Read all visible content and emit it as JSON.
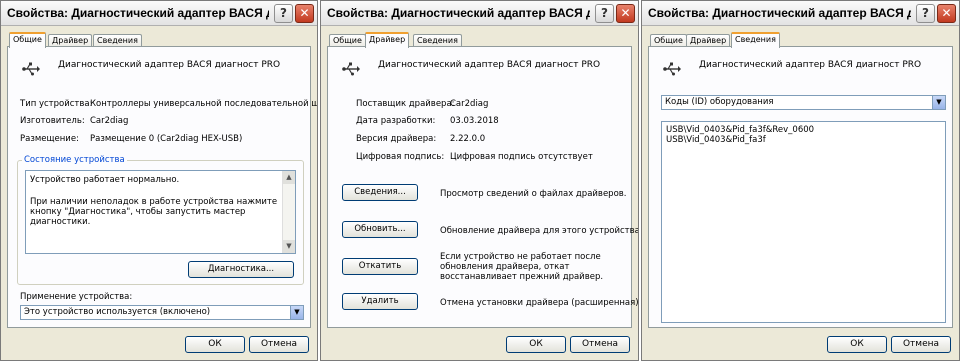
{
  "window_title": "Свойства: Диагностический адаптер ВАСЯ диагнос",
  "help_glyph": "?",
  "close_glyph": "✕",
  "tabs": [
    "Общие",
    "Драйвер",
    "Сведения"
  ],
  "device_name": "Диагностический адаптер ВАСЯ диагност PRO",
  "ok_label": "ОК",
  "cancel_label": "Отмена",
  "general": {
    "type_label": "Тип устройства:",
    "type_value": "Контроллеры универсальной последовательной шин",
    "manufacturer_label": "Изготовитель:",
    "manufacturer_value": "Car2diag",
    "location_label": "Размещение:",
    "location_value": "Размещение 0 (Car2diag HEX-USB)",
    "status_group_title": "Состояние устройства",
    "status_line1": "Устройство работает нормально.",
    "status_line2": "При наличии неполадок в работе устройства нажмите кнопку \"Диагностика\", чтобы запустить мастер диагностики.",
    "diagnostics_button": "Диагностика...",
    "usage_label": "Применение устройства:",
    "usage_value": "Это устройство используется (включено)"
  },
  "driver": {
    "provider_label": "Поставщик драйвера:",
    "provider_value": "Car2diag",
    "date_label": "Дата разработки:",
    "date_value": "03.03.2018",
    "version_label": "Версия драйвера:",
    "version_value": "2.22.0.0",
    "signer_label": "Цифровая подпись:",
    "signer_value": "Цифровая подпись отсутствует",
    "details_button": "Сведения...",
    "details_desc": "Просмотр сведений о файлах драйверов.",
    "update_button": "Обновить...",
    "update_desc": "Обновление драйвера для этого устройства.",
    "rollback_button": "Откатить",
    "rollback_desc": "Если устройство не работает после обновления драйвера, откат восстанавливает прежний драйвер.",
    "uninstall_button": "Удалить",
    "uninstall_desc": "Отмена установки драйвера (расширенная)."
  },
  "details": {
    "property_value": "Коды (ID) оборудования",
    "values": [
      "USB\\Vid_0403&Pid_fa3f&Rev_0600",
      "USB\\Vid_0403&Pid_fa3f"
    ]
  }
}
